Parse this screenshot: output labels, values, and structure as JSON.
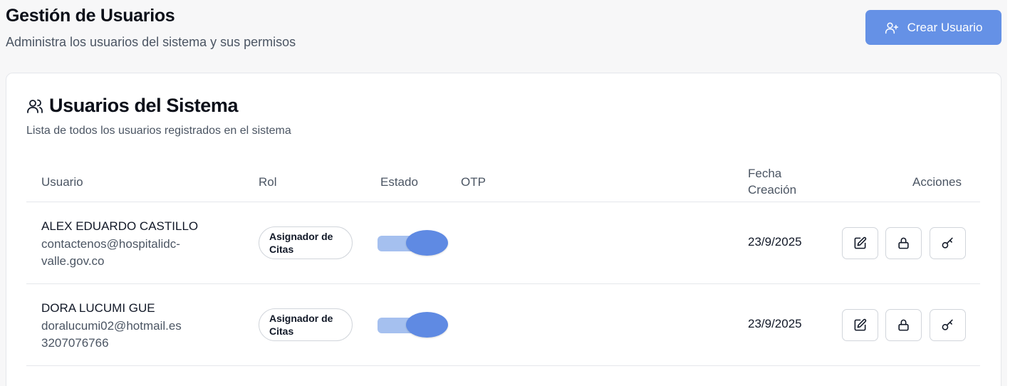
{
  "header": {
    "title": "Gestión de Usuarios",
    "subtitle": "Administra los usuarios del sistema y sus permisos",
    "create_button_label": "Crear Usuario",
    "create_button_icon": "user-plus-icon"
  },
  "card": {
    "title": "Usuarios del Sistema",
    "title_icon": "users-icon",
    "description": "Lista de todos los usuarios registrados en el sistema"
  },
  "table": {
    "columns": {
      "usuario": "Usuario",
      "rol": "Rol",
      "estado": "Estado",
      "otp": "OTP",
      "fecha_line1": "Fecha",
      "fecha_line2": "Creación",
      "acciones": "Acciones"
    },
    "rows": [
      {
        "name": "ALEX EDUARDO CASTILLO",
        "email": "contactenos@hospitalidc-valle.gov.co",
        "role_line1": "Asignador de",
        "role_line2": "Citas",
        "active": true,
        "otp": "",
        "date": "23/9/2025"
      },
      {
        "name": "DORA LUCUMI GUE",
        "email": "doralucumi02@hotmail.es",
        "phone": "3207076766",
        "role_line1": "Asignador de",
        "role_line2": "Citas",
        "active": true,
        "otp": "",
        "date": "23/9/2025"
      }
    ],
    "action_icons": [
      "edit-icon",
      "lock-icon",
      "key-icon"
    ]
  },
  "colors": {
    "accent": "#6591e6",
    "toggle_track": "#a5c0ef",
    "toggle_thumb": "#5f8ae3",
    "background": "#f7f7f8"
  }
}
